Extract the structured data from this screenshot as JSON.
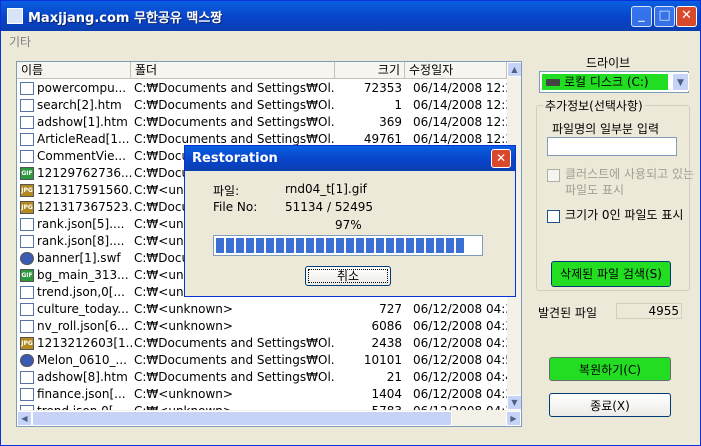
{
  "window": {
    "title": "Maxjjang.com 무한공유 맥스짱",
    "menu": [
      "기타"
    ]
  },
  "list": {
    "columns": [
      "이름",
      "폴더",
      "크기",
      "수정일자"
    ],
    "rows": [
      {
        "icon": "file",
        "name": "powercompu...",
        "folder": "C:₩Documents and Settings₩Ol...",
        "size": "72353",
        "date": "06/14/2008 12:32"
      },
      {
        "icon": "file",
        "name": "search[2].htm",
        "folder": "C:₩Documents and Settings₩Ol...",
        "size": "1",
        "date": "06/14/2008 12:32"
      },
      {
        "icon": "file",
        "name": "adshow[1].htm",
        "folder": "C:₩Documents and Settings₩Ol...",
        "size": "369",
        "date": "06/14/2008 12:32"
      },
      {
        "icon": "file",
        "name": "ArticleRead[1...",
        "folder": "C:₩Documents and Settings₩Ol...",
        "size": "49761",
        "date": "06/14/2008 12:32"
      },
      {
        "icon": "file",
        "name": "CommentVie...",
        "folder": "C:₩Docu",
        "size": "",
        "date": ""
      },
      {
        "icon": "gif",
        "name": "12129762736...",
        "folder": "C:₩Docu",
        "size": "",
        "date": ""
      },
      {
        "icon": "jpg",
        "name": "121317591560...",
        "folder": "C:₩<unkn",
        "size": "",
        "date": ""
      },
      {
        "icon": "jpg",
        "name": "121317367523...",
        "folder": "C:₩Docu",
        "size": "",
        "date": ""
      },
      {
        "icon": "file",
        "name": "rank.json[5]....",
        "folder": "C:₩<unkn",
        "size": "",
        "date": ""
      },
      {
        "icon": "file",
        "name": "rank.json[8]....",
        "folder": "C:₩<unkn",
        "size": "",
        "date": ""
      },
      {
        "icon": "swf",
        "name": "banner[1].swf",
        "folder": "C:₩Docu",
        "size": "",
        "date": ""
      },
      {
        "icon": "gif",
        "name": "bg_main_313...",
        "folder": "C:₩<unkn",
        "size": "",
        "date": ""
      },
      {
        "icon": "file",
        "name": "trend.json,0[...",
        "folder": "C:₩<unkn",
        "size": "",
        "date": ""
      },
      {
        "icon": "file",
        "name": "culture_today...",
        "folder": "C:₩<unknown>",
        "size": "727",
        "date": "06/12/2008 04:37"
      },
      {
        "icon": "file",
        "name": "nv_roll.json[6...",
        "folder": "C:₩<unknown>",
        "size": "6086",
        "date": "06/12/2008 04:37"
      },
      {
        "icon": "jpg",
        "name": "1213212603[1...",
        "folder": "C:₩Documents and Settings₩Ol...",
        "size": "2438",
        "date": "06/12/2008 04:37"
      },
      {
        "icon": "swf",
        "name": "Melon_0610_...",
        "folder": "C:₩Documents and Settings₩Ol...",
        "size": "10101",
        "date": "06/12/2008 04:59"
      },
      {
        "icon": "file",
        "name": "adshow[8].htm",
        "folder": "C:₩Documents and Settings₩Ol...",
        "size": "21",
        "date": "06/12/2008 04:47"
      },
      {
        "icon": "file",
        "name": "finance.json[...",
        "folder": "C:₩<unknown>",
        "size": "1404",
        "date": "06/12/2008 04:37"
      },
      {
        "icon": "file",
        "name": "trend.json,0[...",
        "folder": "C:₩<unknown>",
        "size": "5783",
        "date": "06/12/2008 04:37"
      }
    ]
  },
  "panel": {
    "drive_label": "드라이브",
    "drive_value": "로컬 디스크 (C:)",
    "group_title": "추가정보(선택사항)",
    "part_name_label": "파일명의 일부분 입력",
    "part_name_value": "",
    "check_cluster": "클러스트에 사용되고 있는 파일도 표시",
    "check_zero": "크기가 0인 파일도 표시",
    "search_button": "삭제된 파일 검색(S)",
    "found_label": "발견된 파일",
    "found_value": "4955",
    "restore_button": "복원하기(C)",
    "exit_button": "종료(X)"
  },
  "dialog": {
    "title": "Restoration",
    "file_label": "파일:",
    "file_value": "rnd04_t[1].gif",
    "fileno_label": "File No:",
    "fileno_value": "51134 / 52495",
    "percent_text": "97%",
    "progress": 0.97,
    "cancel_button": "취소"
  },
  "colors": {
    "title_blue": "#0842c8",
    "highlight_green": "#22dd22",
    "progress_blue": "#3b6fd4"
  }
}
